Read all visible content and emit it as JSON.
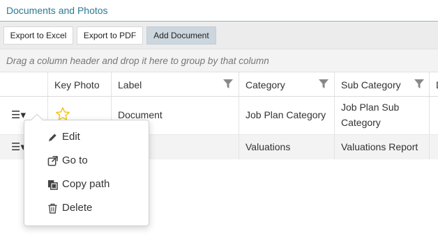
{
  "panel": {
    "title": "Documents and Photos"
  },
  "toolbar": {
    "export_excel": "Export to Excel",
    "export_pdf": "Export to PDF",
    "add_document": "Add Document"
  },
  "group_panel": {
    "hint": "Drag a column header and drop it here to group by that column"
  },
  "grid": {
    "columns": [
      {
        "label": ""
      },
      {
        "label": "Key Photo"
      },
      {
        "label": "Label"
      },
      {
        "label": "Category"
      },
      {
        "label": "Sub Category"
      },
      {
        "label": "D"
      }
    ],
    "rows": [
      {
        "key_photo": "star",
        "label": "Document",
        "category": "Job Plan Category",
        "sub_category_line1": "Job Plan Sub",
        "sub_category_line2": "Category"
      },
      {
        "label": "",
        "category": "Valuations",
        "sub_category": "Valuations Report"
      }
    ]
  },
  "context_menu": {
    "items": [
      {
        "label": "Edit",
        "icon": "pencil-icon"
      },
      {
        "label": "Go to",
        "icon": "external-link-icon"
      },
      {
        "label": "Copy path",
        "icon": "copy-icon"
      },
      {
        "label": "Delete",
        "icon": "trash-icon"
      }
    ]
  },
  "colors": {
    "title": "#2a7a93",
    "toolbar_bg": "#ececec",
    "active_button": "#ccd6df",
    "star": "#f0c419"
  }
}
